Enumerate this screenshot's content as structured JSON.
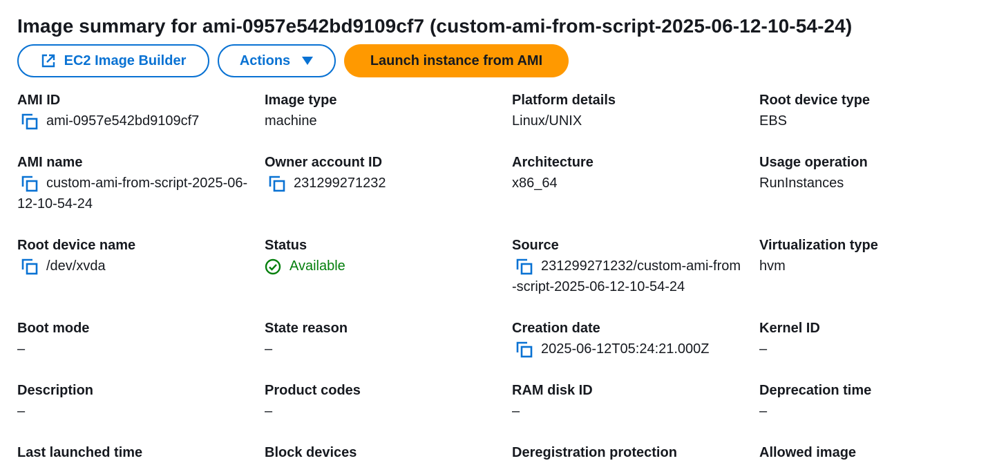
{
  "header": {
    "title": "Image summary for ami-0957e542bd9109cf7 (custom-ami-from-script-2025-06-12-10-54-24)"
  },
  "toolbar": {
    "builder_label": "EC2 Image Builder",
    "actions_label": "Actions",
    "launch_label": "Launch instance from AMI"
  },
  "colors": {
    "link_blue": "#0972d3",
    "launch_orange": "#ff9900",
    "status_green": "#037f0c"
  },
  "fields": {
    "ami_id": {
      "label": "AMI ID",
      "value": "ami-0957e542bd9109cf7"
    },
    "image_type": {
      "label": "Image type",
      "value": "machine"
    },
    "platform_details": {
      "label": "Platform details",
      "value": "Linux/UNIX"
    },
    "root_device_type": {
      "label": "Root device type",
      "value": "EBS"
    },
    "ami_name": {
      "label": "AMI name",
      "value": "custom-ami-from-script-2025-06-12-10-54-24"
    },
    "owner_account_id": {
      "label": "Owner account ID",
      "value": "231299271232"
    },
    "architecture": {
      "label": "Architecture",
      "value": "x86_64"
    },
    "usage_operation": {
      "label": "Usage operation",
      "value": "RunInstances"
    },
    "root_device_name": {
      "label": "Root device name",
      "value": "/dev/xvda"
    },
    "status": {
      "label": "Status",
      "value": "Available"
    },
    "source": {
      "label": "Source",
      "value": "231299271232/custom-ami-from-script-2025-06-12-10-54-24"
    },
    "virtualization_type": {
      "label": "Virtualization type",
      "value": "hvm"
    },
    "boot_mode": {
      "label": "Boot mode",
      "value": "–"
    },
    "state_reason": {
      "label": "State reason",
      "value": "–"
    },
    "creation_date": {
      "label": "Creation date",
      "value": "2025-06-12T05:24:21.000Z"
    },
    "kernel_id": {
      "label": "Kernel ID",
      "value": "–"
    },
    "description": {
      "label": "Description",
      "value": "–"
    },
    "product_codes": {
      "label": "Product codes",
      "value": "–"
    },
    "ram_disk_id": {
      "label": "RAM disk ID",
      "value": "–"
    },
    "deprecation_time": {
      "label": "Deprecation time",
      "value": "–"
    },
    "last_launched_time": {
      "label": "Last launched time"
    },
    "block_devices": {
      "label": "Block devices"
    },
    "deregistration_protection": {
      "label": "Deregistration protection"
    },
    "allowed_image": {
      "label": "Allowed image"
    }
  }
}
